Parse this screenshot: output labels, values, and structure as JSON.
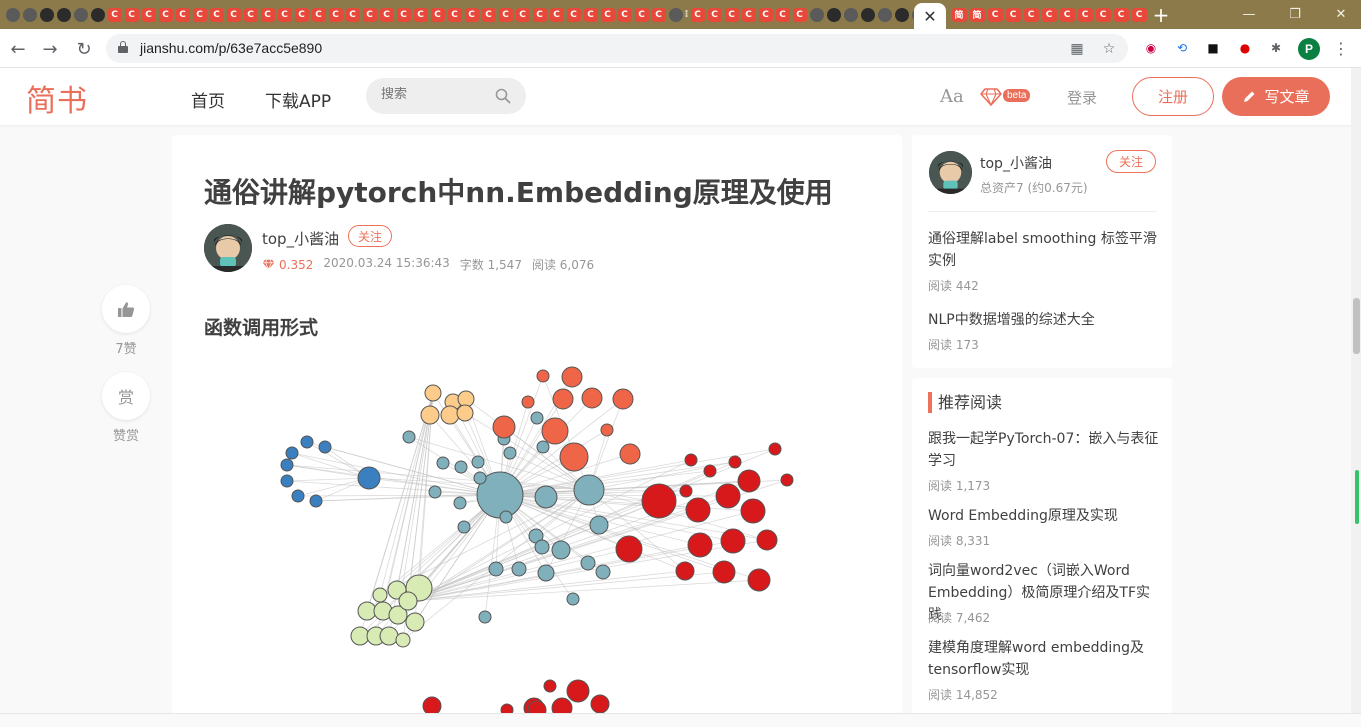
{
  "browser": {
    "url": "jianshu.com/p/63e7acc5e890",
    "profile_initial": "P",
    "tabs_left": [
      "g",
      "g",
      "d",
      "d",
      "g",
      "d",
      "c",
      "c",
      "c",
      "c",
      "c",
      "c",
      "c",
      "c",
      "c",
      "c",
      "c",
      "c",
      "c",
      "c",
      "c",
      "c",
      "c",
      "c",
      "c",
      "c",
      "c",
      "c",
      "c",
      "c",
      "c",
      "c",
      "c",
      "c",
      "c",
      "c",
      "c",
      "c",
      "c",
      "g",
      "sep",
      "c",
      "c",
      "c",
      "c",
      "c",
      "c",
      "c",
      "g",
      "d",
      "g",
      "d",
      "g",
      "d",
      "g",
      "d",
      "c",
      "c",
      "c",
      "g"
    ],
    "tabs_right": [
      "简",
      "简",
      "C",
      "C",
      "C",
      "C",
      "C",
      "C",
      "C",
      "C",
      "C"
    ],
    "active_close": "✕",
    "new_tab": "+"
  },
  "header": {
    "logo": "简书",
    "nav_home": "首页",
    "nav_app": "下载APP",
    "search_placeholder": "搜索",
    "font_setting": "Aa",
    "beta": "beta",
    "login": "登录",
    "signup": "注册",
    "write": "写文章"
  },
  "side_actions": {
    "like_count": "7赞",
    "reward_icon": "赏",
    "reward_label": "赞赏"
  },
  "article": {
    "title": "通俗讲解pytorch中nn.Embedding原理及使用",
    "author": "top_小酱油",
    "follow": "关注",
    "diamond": "0.352",
    "date": "2020.03.24 15:36:43",
    "words": "字数 1,547",
    "reads": "阅读 6,076",
    "section_heading": "函数调用形式"
  },
  "sidebar": {
    "author": "top_小酱油",
    "assets": "总资产7 (约0.67元)",
    "follow": "关注",
    "author_articles": [
      {
        "title": "通俗理解label smoothing 标签平滑实例",
        "reads": "阅读 442"
      },
      {
        "title": "NLP中数据增强的综述大全",
        "reads": "阅读 173"
      }
    ],
    "recommend_title": "推荐阅读",
    "recommended": [
      {
        "title": "跟我一起学PyTorch-07：嵌入与表征学习",
        "reads": "阅读 1,173"
      },
      {
        "title": "Word Embedding原理及实现",
        "reads": "阅读 8,331"
      },
      {
        "title": "词向量word2vec（词嵌入Word Embedding）极简原理介绍及TF实践",
        "reads": "阅读 7,462"
      },
      {
        "title": "建模角度理解word embedding及tensorflow实现",
        "reads": "阅读 14,852"
      }
    ]
  },
  "colors": {
    "brand": "#ea6f5a",
    "node_teal": "#7fb0bb",
    "node_red": "#d7191c",
    "node_orange": "#ef6548",
    "node_peach": "#fdcc8a",
    "node_green": "#d9ebb5",
    "node_blue": "#3a7fbf"
  }
}
